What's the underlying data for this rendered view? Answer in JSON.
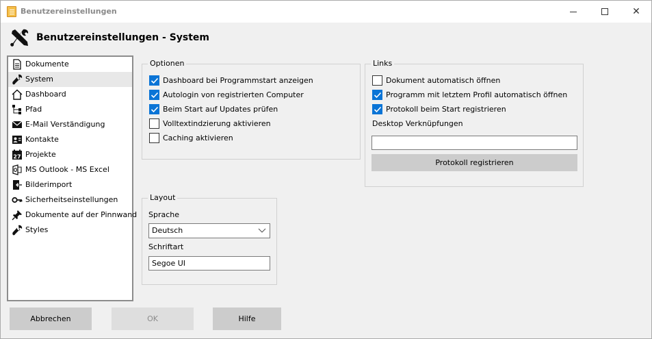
{
  "window": {
    "title": "Benutzereinstellungen",
    "controls": {
      "minimize": "minimize",
      "maximize": "maximize",
      "close": "✕"
    }
  },
  "header": {
    "title": "Benutzereinstellungen - System"
  },
  "sidebar": {
    "items": [
      {
        "label": "Dokumente",
        "icon": "document-icon"
      },
      {
        "label": "System",
        "icon": "wrench-icon",
        "selected": true
      },
      {
        "label": "Dashboard",
        "icon": "home-icon"
      },
      {
        "label": "Pfad",
        "icon": "tree-icon"
      },
      {
        "label": "E-Mail Verständigung",
        "icon": "mail-icon"
      },
      {
        "label": "Kontakte",
        "icon": "contact-card-icon"
      },
      {
        "label": "Projekte",
        "icon": "calendar-icon"
      },
      {
        "label": "MS Outlook - MS Excel",
        "icon": "outlook-icon"
      },
      {
        "label": "Bilderimport",
        "icon": "import-icon"
      },
      {
        "label": "Sicherheitseinstellungen",
        "icon": "key-icon"
      },
      {
        "label": "Dokumente auf der Pinnwand",
        "icon": "pin-icon"
      },
      {
        "label": "Styles",
        "icon": "wrench-icon"
      }
    ],
    "calendar_day": "27"
  },
  "optionen": {
    "legend": "Optionen",
    "items": [
      {
        "label": "Dashboard bei Programmstart anzeigen",
        "checked": true
      },
      {
        "label": "Autologin von registrierten Computer",
        "checked": true
      },
      {
        "label": "Beim Start auf Updates prüfen",
        "checked": true
      },
      {
        "label": "Volltextindzierung aktivieren",
        "checked": false
      },
      {
        "label": "Caching aktivieren",
        "checked": false
      }
    ]
  },
  "links": {
    "legend": "Links",
    "items": [
      {
        "label": "Dokument automatisch öffnen",
        "checked": false
      },
      {
        "label": "Programm mit letztem Profil automatisch öffnen",
        "checked": true
      },
      {
        "label": "Protokoll beim Start registrieren",
        "checked": true
      }
    ],
    "desktop_label": "Desktop Verknüpfungen",
    "desktop_value": "",
    "protokoll_button": "Protokoll registrieren"
  },
  "layout": {
    "legend": "Layout",
    "sprache_label": "Sprache",
    "sprache_value": "Deutsch",
    "schriftart_label": "Schriftart",
    "schriftart_value": "Segoe UI"
  },
  "footer": {
    "cancel": "Abbrechen",
    "ok": "OK",
    "help": "Hilfe"
  },
  "colors": {
    "checkbox_checked": "#0a74d6",
    "button_bg": "#cccccc",
    "window_bg": "#f0f0f0"
  }
}
